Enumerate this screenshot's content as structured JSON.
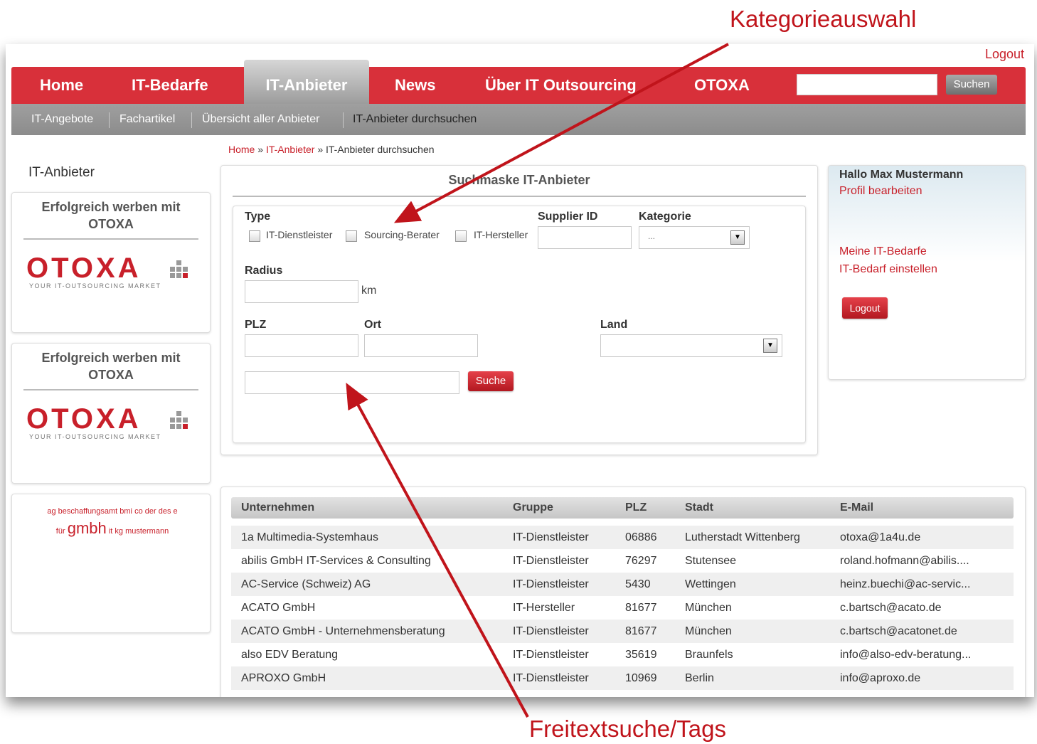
{
  "annotations": {
    "category": "Kategorieauswahl",
    "freetext": "Freitextsuche/Tags"
  },
  "header": {
    "logout": "Logout",
    "nav": [
      "Home",
      "IT-Bedarfe",
      "IT-Anbieter",
      "News",
      "Über IT Outsourcing",
      "OTOXA"
    ],
    "search_button": "Suchen"
  },
  "subnav": [
    "IT-Angebote",
    "Fachartikel",
    "Übersicht aller Anbieter",
    "IT-Anbieter durchsuchen"
  ],
  "breadcrumb": {
    "home": "Home",
    "sep": "»",
    "section": "IT-Anbieter",
    "current": "IT-Anbieter durchsuchen"
  },
  "sidebar": {
    "heading": "IT-Anbieter",
    "ad_title": "Erfolgreich werben mit OTOXA",
    "logo": "OTOXA",
    "logo_tagline": "YOUR IT-OUTSOURCING MARKET",
    "tags": [
      "ag",
      "beschaffungsamt",
      "bmi",
      "co",
      "der",
      "des",
      "e",
      "für",
      "gmbh",
      "it",
      "kg",
      "mustermann"
    ]
  },
  "search": {
    "title": "Suchmaske IT-Anbieter",
    "type_label": "Type",
    "types": [
      "IT-Dienstleister",
      "Sourcing-Berater",
      "IT-Hersteller"
    ],
    "supplier_label": "Supplier ID",
    "category_label": "Kategorie",
    "category_value": "...",
    "radius_label": "Radius",
    "radius_unit": "km",
    "plz_label": "PLZ",
    "ort_label": "Ort",
    "land_label": "Land",
    "search_button": "Suche"
  },
  "user": {
    "greeting": "Hallo Max Mustermann",
    "profile": "Profil bearbeiten",
    "my_needs": "Meine IT-Bedarfe",
    "add_need": "IT-Bedarf einstellen",
    "logout": "Logout"
  },
  "table": {
    "headers": [
      "Unternehmen",
      "Gruppe",
      "PLZ",
      "Stadt",
      "E-Mail"
    ],
    "rows": [
      [
        "1a Multimedia-Systemhaus",
        "IT-Dienstleister",
        "06886",
        "Lutherstadt Wittenberg",
        "otoxa@1a4u.de"
      ],
      [
        "abilis GmbH IT-Services & Consulting",
        "IT-Dienstleister",
        "76297",
        "Stutensee",
        "roland.hofmann@abilis...."
      ],
      [
        "AC-Service (Schweiz) AG",
        "IT-Dienstleister",
        "5430",
        "Wettingen",
        "heinz.buechi@ac-servic..."
      ],
      [
        "ACATO GmbH",
        "IT-Hersteller",
        "81677",
        "München",
        "c.bartsch@acato.de"
      ],
      [
        "ACATO GmbH - Unternehmensberatung",
        "IT-Dienstleister",
        "81677",
        "München",
        "c.bartsch@acatonet.de"
      ],
      [
        "also EDV Beratung",
        "IT-Dienstleister",
        "35619",
        "Braunfels",
        "info@also-edv-beratung..."
      ],
      [
        "APROXO GmbH",
        "IT-Dienstleister",
        "10969",
        "Berlin",
        "info@aproxo.de"
      ]
    ]
  },
  "colors": {
    "brand_red": "#d8303a",
    "link_red": "#c8202a",
    "annotation_red": "#c0141b",
    "subnav_gray": "#969696"
  }
}
